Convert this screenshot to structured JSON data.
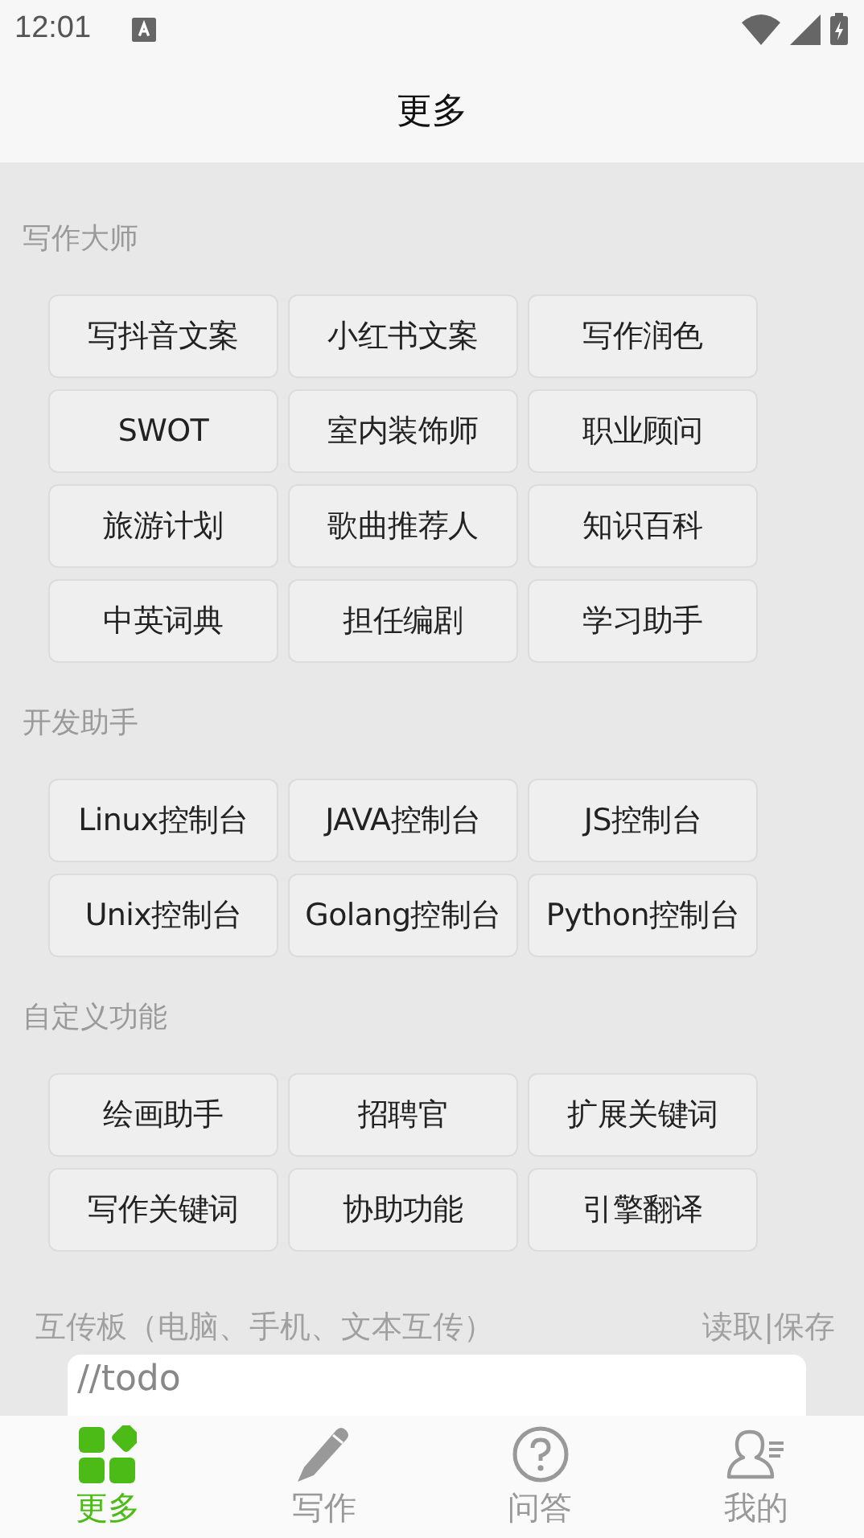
{
  "status_bar": {
    "time": "12:01"
  },
  "header": {
    "title": "更多"
  },
  "sections": [
    {
      "title": "写作大师",
      "buttons": [
        "写抖音文案",
        "小红书文案",
        "写作润色",
        "SWOT",
        "室内装饰师",
        "职业顾问",
        "旅游计划",
        "歌曲推荐人",
        "知识百科",
        "中英词典",
        "担任编剧",
        "学习助手"
      ]
    },
    {
      "title": "开发助手",
      "buttons": [
        "Linux控制台",
        "JAVA控制台",
        "JS控制台",
        "Unix控制台",
        "Golang控制台",
        "Python控制台"
      ]
    },
    {
      "title": "自定义功能",
      "buttons": [
        "绘画助手",
        "招聘官",
        "扩展关键词",
        "写作关键词",
        "协助功能",
        "引擎翻译"
      ]
    }
  ],
  "clipboard": {
    "label": "互传板（电脑、手机、文本互传）",
    "actions": [
      "读取",
      "保存"
    ],
    "separator": "|",
    "value": "//todo"
  },
  "tabs": [
    {
      "kind": "apps",
      "label": "更多",
      "selected": true
    },
    {
      "kind": "pen",
      "label": "写作",
      "selected": false
    },
    {
      "kind": "question",
      "label": "问答",
      "selected": false
    },
    {
      "kind": "user",
      "label": "我的",
      "selected": false
    }
  ]
}
